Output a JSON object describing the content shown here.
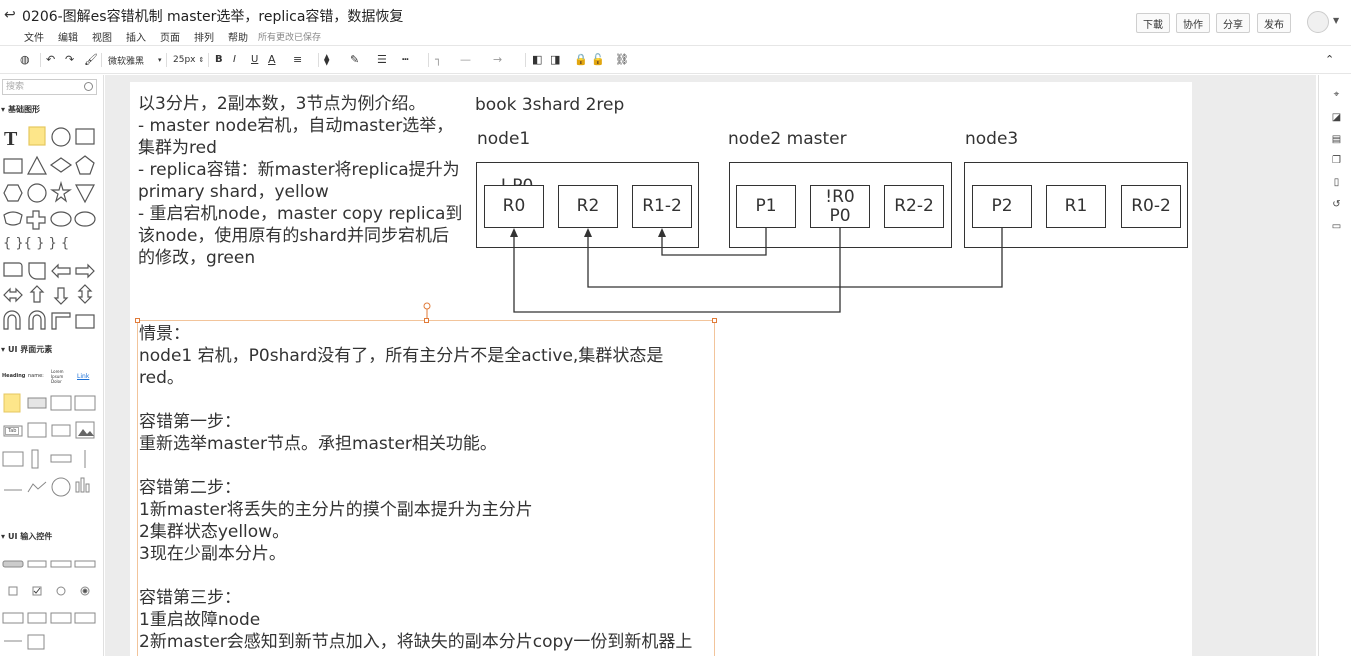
{
  "app": {
    "title": "0206-图解es容错机制 master选举，replica容错，数据恢复",
    "menu": [
      "文件",
      "编辑",
      "视图",
      "插入",
      "页面",
      "排列",
      "帮助"
    ],
    "save_status": "所有更改已保存",
    "buttons": {
      "download": "下載",
      "collaborate": "协作",
      "share": "分享",
      "publish": "发布"
    }
  },
  "toolbar": {
    "font_family": "微软雅黑",
    "font_size": "25px",
    "bold": "B",
    "italic": "I",
    "underline": "U",
    "font_color": "A"
  },
  "sidebar": {
    "search_placeholder": "搜索",
    "sections": {
      "basic": "基础图形",
      "ui_elements": "UI 界面元素",
      "ui_inputs": "UI 输入控件"
    },
    "ui_samples": {
      "heading": "Heading",
      "name": "name:",
      "lorem": "Lorem Ipsum Dolor",
      "link": "Link",
      "tab": "Tab"
    }
  },
  "diagram": {
    "intro_lines": [
      "以3分片，2副本数，3节点为例介绍。",
      "- master node宕机，自动master选举，",
      "集群为red",
      "- replica容错：新master将replica提升为",
      "primary shard，yellow",
      "- 重启宕机node，master copy replica到",
      "该node，使用原有的shard并同步宕机后",
      "的修改，green"
    ],
    "heading": "book 3shard 2rep",
    "nodes": {
      "node1": {
        "label": "node1",
        "marker": "! P0",
        "shards": [
          "R0",
          "R2",
          "R1-2"
        ]
      },
      "node2": {
        "label": "node2  master",
        "shards": [
          "P1",
          "!R0",
          "P0",
          "R2-2"
        ]
      },
      "node3": {
        "label": "node3",
        "shards": [
          "P2",
          "R1",
          "R0-2"
        ]
      }
    }
  },
  "notes": {
    "lines": [
      "情景：",
      "node1 宕机，P0shard没有了，所有主分片不是全active,集群状态是",
      "red。",
      "",
      "容错第一步：",
      "重新选举master节点。承担master相关功能。",
      "",
      "容错第二步：",
      "1新master将丢失的主分片的摸个副本提升为主分片",
      "2集群状态yellow。",
      "3现在少副本分片。",
      "",
      "容错第三步：",
      "1重启故障node",
      "2新master会感知到新节点加入，将缺失的副本分片copy一份到新机器上"
    ]
  }
}
